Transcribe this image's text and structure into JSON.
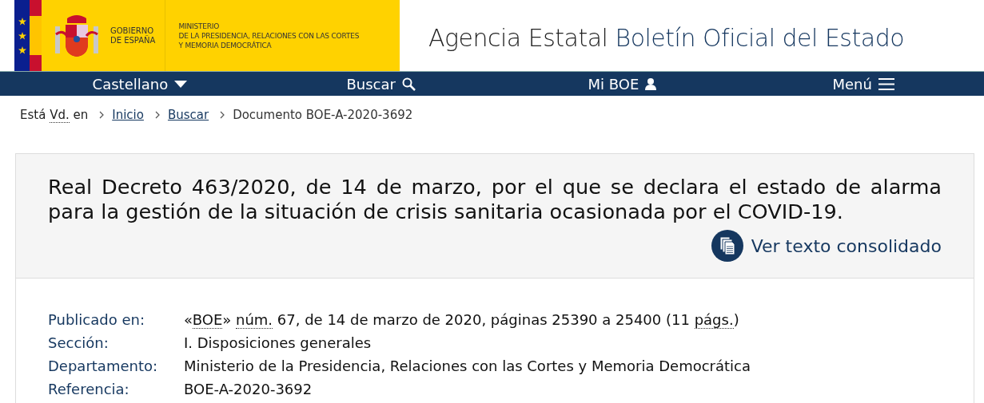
{
  "header": {
    "logo": {
      "gov_lines": [
        "GOBIERNO",
        "DE ESPAÑA"
      ],
      "ministry_lines": [
        "MINISTERIO",
        "DE LA PRESIDENCIA, RELACIONES CON LAS CORTES",
        "Y MEMORIA DEMOCRÁTICA"
      ]
    },
    "site_title": {
      "prefix": "Agencia Estatal",
      "name": "Boletín Oficial del Estado"
    }
  },
  "nav": [
    {
      "label": "Castellano",
      "kind": "language"
    },
    {
      "label": "Buscar",
      "kind": "search"
    },
    {
      "label": "Mi BOE",
      "kind": "user"
    },
    {
      "label": "Menú",
      "kind": "menu"
    }
  ],
  "breadcrumb": {
    "intro": [
      {
        "text": "Está ",
        "abbr": false
      },
      {
        "text": "Vd.",
        "abbr": true
      },
      {
        "text": " en",
        "abbr": false
      }
    ],
    "items": [
      {
        "label": "Inicio",
        "link": true
      },
      {
        "label": "Buscar",
        "link": true
      },
      {
        "label": "Documento BOE-A-2020-3692",
        "link": false
      }
    ]
  },
  "document": {
    "title": "Real Decreto 463/2020, de 14 de marzo, por el que se declara el estado de alarma para la gestión de la situación de crisis sanitaria ocasionada por el COVID-19.",
    "consolidated_link": "Ver texto consolidado",
    "metadata": [
      {
        "label": "Publicado en:",
        "value": [
          {
            "text": "«",
            "abbr": false
          },
          {
            "text": "BOE",
            "abbr": true
          },
          {
            "text": "» ",
            "abbr": false
          },
          {
            "text": "núm.",
            "abbr": true
          },
          {
            "text": " 67, de 14 de marzo de 2020, páginas 25390 a 25400 (11 ",
            "abbr": false
          },
          {
            "text": "págs.",
            "abbr": true
          },
          {
            "text": ")",
            "abbr": false
          }
        ]
      },
      {
        "label": "Sección:",
        "value": [
          {
            "text": "I. Disposiciones generales",
            "abbr": false
          }
        ]
      },
      {
        "label": "Departamento:",
        "value": [
          {
            "text": "Ministerio de la Presidencia, Relaciones con las Cortes y Memoria Democrática",
            "abbr": false
          }
        ]
      },
      {
        "label": "Referencia:",
        "value": [
          {
            "text": "BOE-A-2020-3692",
            "abbr": false
          }
        ]
      }
    ]
  }
}
